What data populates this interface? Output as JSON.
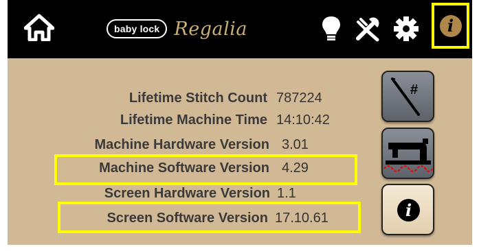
{
  "brand": {
    "oval_text": "baby lock",
    "script_text": "Regalia"
  },
  "info": {
    "rows": [
      {
        "label": "Lifetime Stitch Count",
        "value": "787224"
      },
      {
        "label": "Lifetime Machine Time",
        "value": "14:10:42"
      },
      {
        "label": "Machine Hardware Version",
        "value": "3.01"
      },
      {
        "label": "Machine Software Version",
        "value": "4.29"
      },
      {
        "label": "Screen Hardware Version",
        "value": "1.1"
      },
      {
        "label": "Screen Software Version",
        "value": "17.10.61"
      }
    ]
  },
  "icons": {
    "home": "home-icon",
    "lightbulb": "lightbulb-icon",
    "tools": "tools-icon",
    "settings": "gear-icon",
    "info_top": "info-icon",
    "needle": "needle-stitch-icon",
    "machine": "sewing-machine-icon",
    "info_side": "info-icon"
  },
  "glyphs": {
    "needle_symbol": "#",
    "info_letter": "i"
  },
  "colors": {
    "background": "#d2b996",
    "topbar": "#000000",
    "highlight": "#ffff00",
    "info_accent": "#b0874a"
  }
}
